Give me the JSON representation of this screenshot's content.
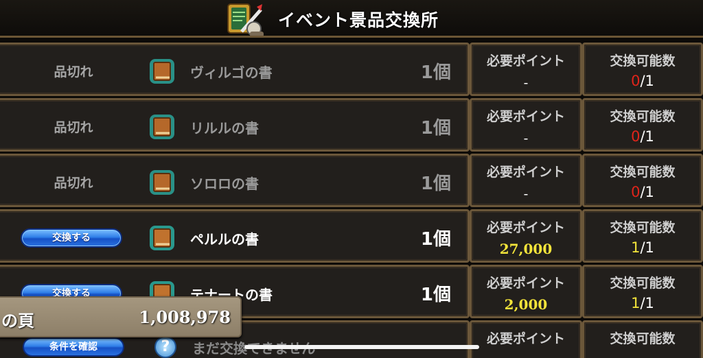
{
  "header": {
    "title": "イベント景品交換所",
    "icon": "treasure-chest-sword-icon"
  },
  "labels": {
    "points": "必要ポイント",
    "count": "交換可能数"
  },
  "rows": [
    {
      "status": "品切れ",
      "name": "ヴィルゴの書",
      "qty": "1個",
      "points": "-",
      "remaining": "0",
      "max": "/1",
      "available": false
    },
    {
      "status": "品切れ",
      "name": "リルルの書",
      "qty": "1個",
      "points": "-",
      "remaining": "0",
      "max": "/1",
      "available": false
    },
    {
      "status": "品切れ",
      "name": "ソロロの書",
      "qty": "1個",
      "points": "-",
      "remaining": "0",
      "max": "/1",
      "available": false
    },
    {
      "status": "交換する",
      "name": "ペルルの書",
      "qty": "1個",
      "points": "27,000",
      "remaining": "1",
      "max": "/1",
      "available": true
    },
    {
      "status": "交換する",
      "name": "テナートの書",
      "qty": "1個",
      "points": "2,000",
      "remaining": "1",
      "max": "/1",
      "available": true
    }
  ],
  "partial_row": {
    "button": "条件を確認",
    "text": "まだ交換できません",
    "icon": "question-bubble-icon"
  },
  "currency": {
    "label": "の頁",
    "value": "1,008,978"
  },
  "colors": {
    "red": "#e0241a",
    "gold": "#f3e43a",
    "button": "#2f7ee8"
  }
}
